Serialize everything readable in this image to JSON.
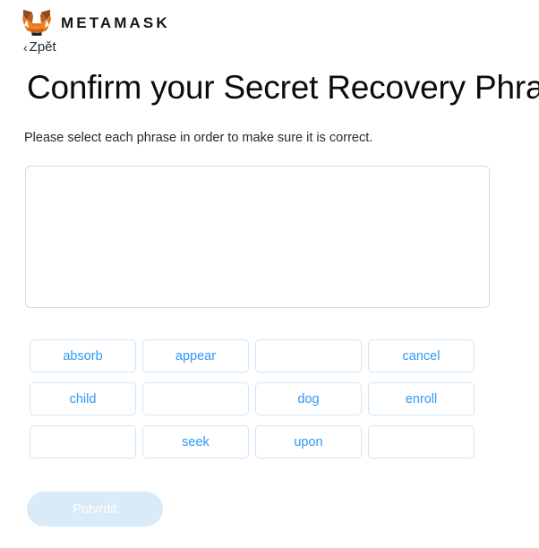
{
  "header": {
    "logo_icon": "metamask-fox-icon",
    "wordmark": "METAMASK",
    "back_label": "Zpět",
    "back_chevron": "‹"
  },
  "main": {
    "title": "Confirm your Secret Recovery Phrase",
    "subtitle": "Please select each phrase in order to make sure it is correct.",
    "dropzone_value": ""
  },
  "word_grid": {
    "words": [
      {
        "label": "absorb",
        "empty": false
      },
      {
        "label": "appear",
        "empty": false
      },
      {
        "label": "",
        "empty": true
      },
      {
        "label": "cancel",
        "empty": false
      },
      {
        "label": "child",
        "empty": false
      },
      {
        "label": "",
        "empty": true
      },
      {
        "label": "dog",
        "empty": false
      },
      {
        "label": "enroll",
        "empty": false
      },
      {
        "label": "",
        "empty": true
      },
      {
        "label": "seek",
        "empty": false
      },
      {
        "label": "upon",
        "empty": false
      },
      {
        "label": "",
        "empty": true
      }
    ]
  },
  "footer": {
    "submit_label": "Potvrdit",
    "submit_disabled": true
  },
  "colors": {
    "accent_blue": "#3098f7",
    "chip_border": "#d0e6fb",
    "dropzone_border": "#d6d9dc",
    "submit_disabled_bg": "#d9eaf9",
    "fox_orange": "#e2761b",
    "fox_dark": "#763d16",
    "text_dark": "#24292e"
  }
}
